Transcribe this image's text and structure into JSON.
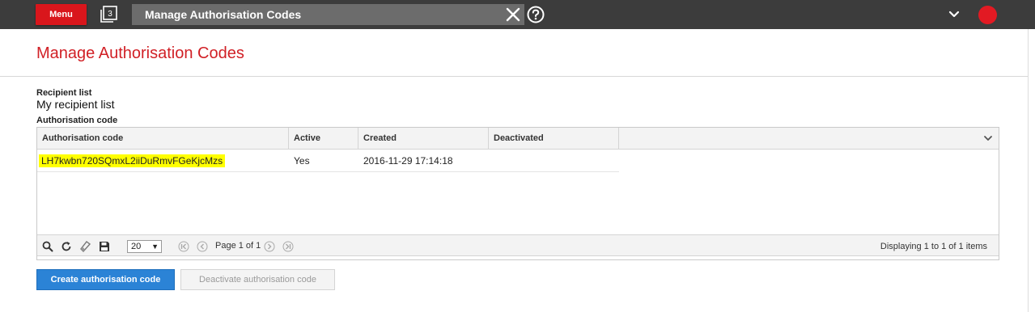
{
  "topbar": {
    "menu_label": "Menu",
    "windows_count": "3",
    "title": "Manage Authorisation Codes",
    "colors": {
      "bar": "#3c3c3c",
      "menu": "#d9161c",
      "avatar": "#e21a23"
    }
  },
  "page": {
    "title": "Manage Authorisation Codes",
    "title_color": "#d12026"
  },
  "recipient": {
    "label": "Recipient list",
    "value": "My recipient list"
  },
  "auth_code_label": "Authorisation code",
  "grid": {
    "columns": [
      "Authorisation code",
      "Active",
      "Created",
      "Deactivated"
    ],
    "rows": [
      {
        "code": "LH7kwbn720SQmxL2iiDuRmvFGeKjcMzs",
        "active": "Yes",
        "created": "2016-11-29 17:14:18",
        "deactivated": ""
      }
    ],
    "footer": {
      "page_size": "20",
      "page_text": "Page 1 of 1",
      "display_text": "Displaying 1 to 1 of 1 items"
    }
  },
  "buttons": {
    "create": "Create authorisation code",
    "deactivate": "Deactivate authorisation code"
  }
}
